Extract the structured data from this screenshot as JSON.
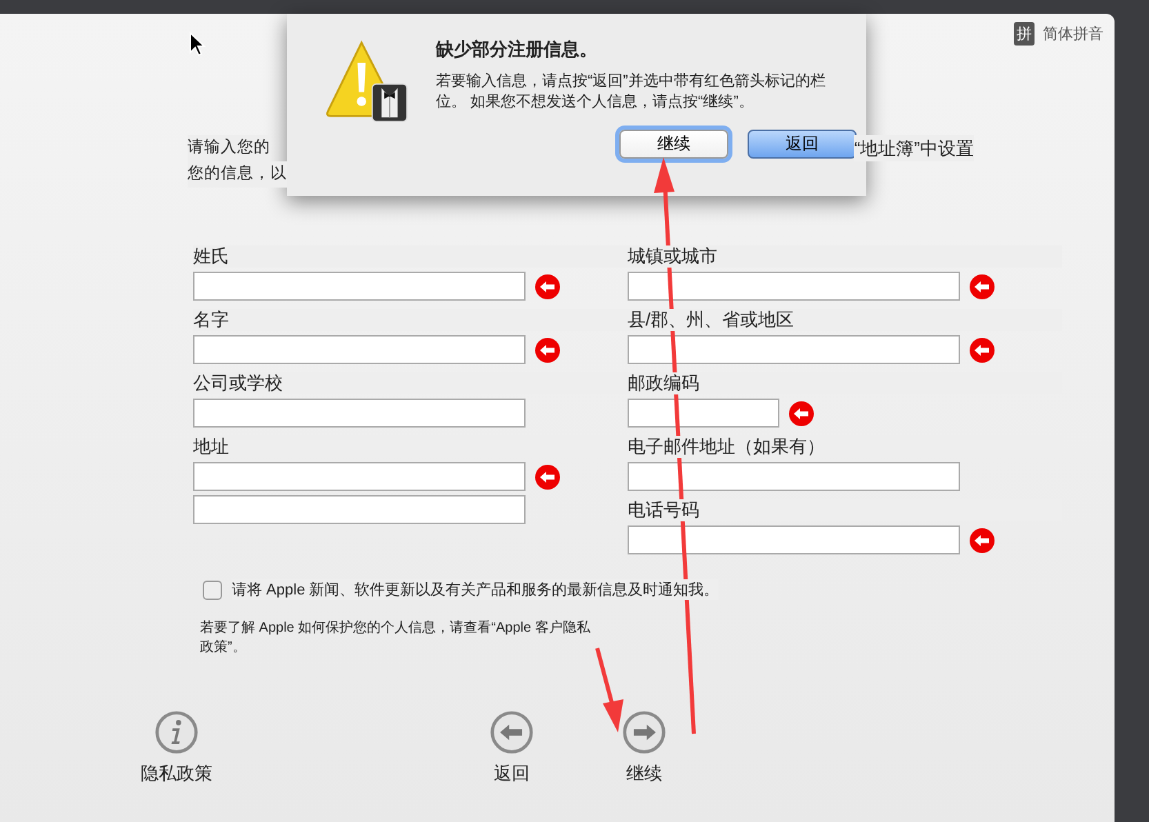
{
  "language_menu": {
    "icon_char": "拼",
    "label": "简体拼音"
  },
  "intro": {
    "line_1_start": "请输入您的",
    "line_1_end": "“地址簿”中设置",
    "line_2_start": "您的信息，以"
  },
  "form": {
    "left": [
      {
        "label": "姓氏",
        "kind": "wide",
        "missing": true
      },
      {
        "label": "名字",
        "kind": "wide",
        "missing": true
      },
      {
        "label": "公司或学校",
        "kind": "wide",
        "missing": false
      },
      {
        "label": "地址",
        "kind": "double",
        "missing": true
      }
    ],
    "right": [
      {
        "label": "城镇或城市",
        "kind": "wide",
        "missing": true
      },
      {
        "label": "县/郡、州、省或地区",
        "kind": "wide",
        "missing": true
      },
      {
        "label": "邮政编码",
        "kind": "short",
        "missing": true
      },
      {
        "label": "电子邮件地址（如果有）",
        "kind": "wide",
        "missing": false
      },
      {
        "label": "电话号码",
        "kind": "wide",
        "missing": true
      }
    ]
  },
  "newsletter": {
    "label": "请将 Apple 新闻、软件更新以及有关产品和服务的最新信息及时通知我。",
    "checked": false
  },
  "privacy_note": "若要了解 Apple 如何保护您的个人信息，请查看“Apple 客户隐私政策”。",
  "footer": [
    {
      "kind": "info",
      "label": "隐私政策"
    },
    {
      "kind": "back",
      "label": "返回"
    },
    {
      "kind": "forward",
      "label": "继续"
    }
  ],
  "dialog": {
    "title": "缺少部分注册信息。",
    "message": "若要输入信息，请点按“返回”并选中带有红色箭头标记的栏位。 如果您不想发送个人信息，请点按“继续”。",
    "buttons": [
      {
        "label": "继续",
        "focused": true,
        "default": false
      },
      {
        "label": "返回",
        "focused": false,
        "default": true
      }
    ]
  }
}
